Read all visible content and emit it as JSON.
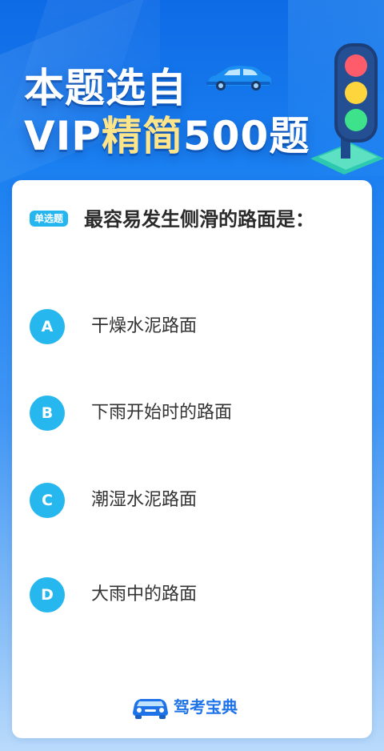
{
  "header": {
    "title_line1": "本题选自",
    "title_vip": "VIP",
    "title_highlight": "精简",
    "title_rest": "500题"
  },
  "question": {
    "type_badge": "单选题",
    "text": "最容易发生侧滑的路面是："
  },
  "options": [
    {
      "letter": "A",
      "text": "干燥水泥路面"
    },
    {
      "letter": "B",
      "text": "下雨开始时的路面"
    },
    {
      "letter": "C",
      "text": "潮湿水泥路面"
    },
    {
      "letter": "D",
      "text": "大雨中的路面"
    }
  ],
  "brand": {
    "name": "驾考宝典",
    "icon": "car-logo-icon"
  },
  "colors": {
    "accent": "#26b7ef",
    "brand_blue": "#1e73e8",
    "title_highlight": "#ffe58a"
  },
  "icons": {
    "title_car": "car-icon",
    "traffic": "traffic-light-icon"
  }
}
